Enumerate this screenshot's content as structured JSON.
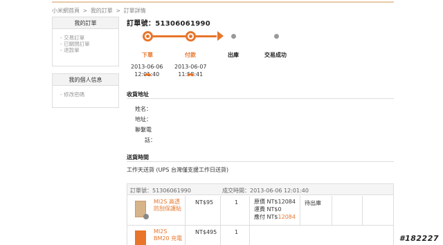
{
  "breadcrumb": {
    "items": [
      "小米網首頁",
      "我的訂單",
      "訂單詳情"
    ],
    "separator": ">"
  },
  "sidebar": {
    "orders_box": {
      "title": "我的訂單",
      "items": [
        "- 交易訂單",
        "- 已關閉訂單",
        "- 退款單"
      ]
    },
    "profile_box": {
      "title": "我的個人信息",
      "items": [
        "- 修改密碼"
      ]
    }
  },
  "order": {
    "title_label": "訂單號：",
    "number": "51306061990"
  },
  "progress": {
    "accent_color": "#e8752a",
    "steps": [
      {
        "label": "下單",
        "status": "done",
        "date": "2013-06-06",
        "time": "12:01:40"
      },
      {
        "label": "付款",
        "status": "done",
        "date": "2013-06-07",
        "time": "11:58:41"
      },
      {
        "label": "出庫",
        "status": "todo"
      },
      {
        "label": "交易成功",
        "status": "todo"
      }
    ]
  },
  "address": {
    "title": "收貨地址",
    "name_label": "姓名：",
    "address_label": "地址：",
    "phone_label_line1": "聯繫電",
    "phone_label_line2": "話："
  },
  "shipping": {
    "title": "送貨時間",
    "value": "工作天送貨 (UPS 台灣僅支援工作日送貨)"
  },
  "order_table": {
    "header_order_label": "訂單號：",
    "header_order_number": "51306061990",
    "header_time_label": "成交時間：",
    "header_time_value": "2013-06-06 12:01:40",
    "rows": [
      {
        "name_line1": "MI2S 高透",
        "name_line2": "防刮保護貼",
        "price": "NT$95",
        "qty": "1",
        "status": "待出庫"
      },
      {
        "name_line1": "MI2S",
        "name_line2": "BM20 充電",
        "price": "NT$495",
        "qty": "1"
      }
    ],
    "summary": {
      "original_label": "原價 ",
      "original_value": "NT$12084",
      "shipping_label": "運費 ",
      "shipping_value": "NT$0",
      "paid_label": "應付 ",
      "paid_prefix": "NT$",
      "paid_value": "12084"
    }
  },
  "watermark": "#182227"
}
